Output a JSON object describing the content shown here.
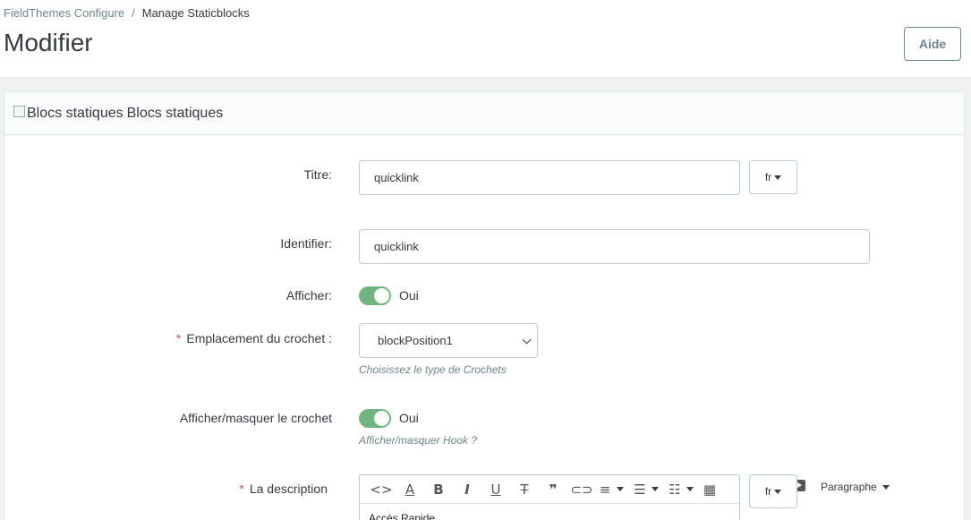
{
  "breadcrumb": {
    "parent": "FieldThemes Configure",
    "separator": "/",
    "current": "Manage Staticblocks"
  },
  "page": {
    "title": "Modifier",
    "help_button": "Aide"
  },
  "panel": {
    "heading_alt": "Blocs statiques",
    "heading": "Blocs statiques"
  },
  "form": {
    "title": {
      "label": "Titre:",
      "value": "quicklink",
      "lang": "fr"
    },
    "identifier": {
      "label": "Identifier:",
      "value": "quicklink"
    },
    "display": {
      "label": "Afficher:",
      "state": "Oui"
    },
    "hook": {
      "required_mark": "*",
      "label": "Emplacement du crochet :",
      "value": "blockPosition1",
      "help": "Choisissez le type de Crochets"
    },
    "hook_toggle": {
      "label": "Afficher/masquer le crochet",
      "state": "Oui",
      "help": "Afficher/masquer Hook ?"
    },
    "description": {
      "required_mark": "*",
      "label": "La description",
      "content": "Accès Rapide",
      "lang": "fr",
      "format": "Paragraphe"
    }
  },
  "editor_toolbar": {
    "icons": [
      "code-icon",
      "text-color-icon",
      "bold-icon",
      "italic-icon",
      "underline-icon",
      "strikethrough-icon",
      "blockquote-icon",
      "link-icon",
      "align-icon",
      "bullet-list-icon",
      "numbered-list-icon",
      "table-icon",
      "media-icon"
    ]
  }
}
